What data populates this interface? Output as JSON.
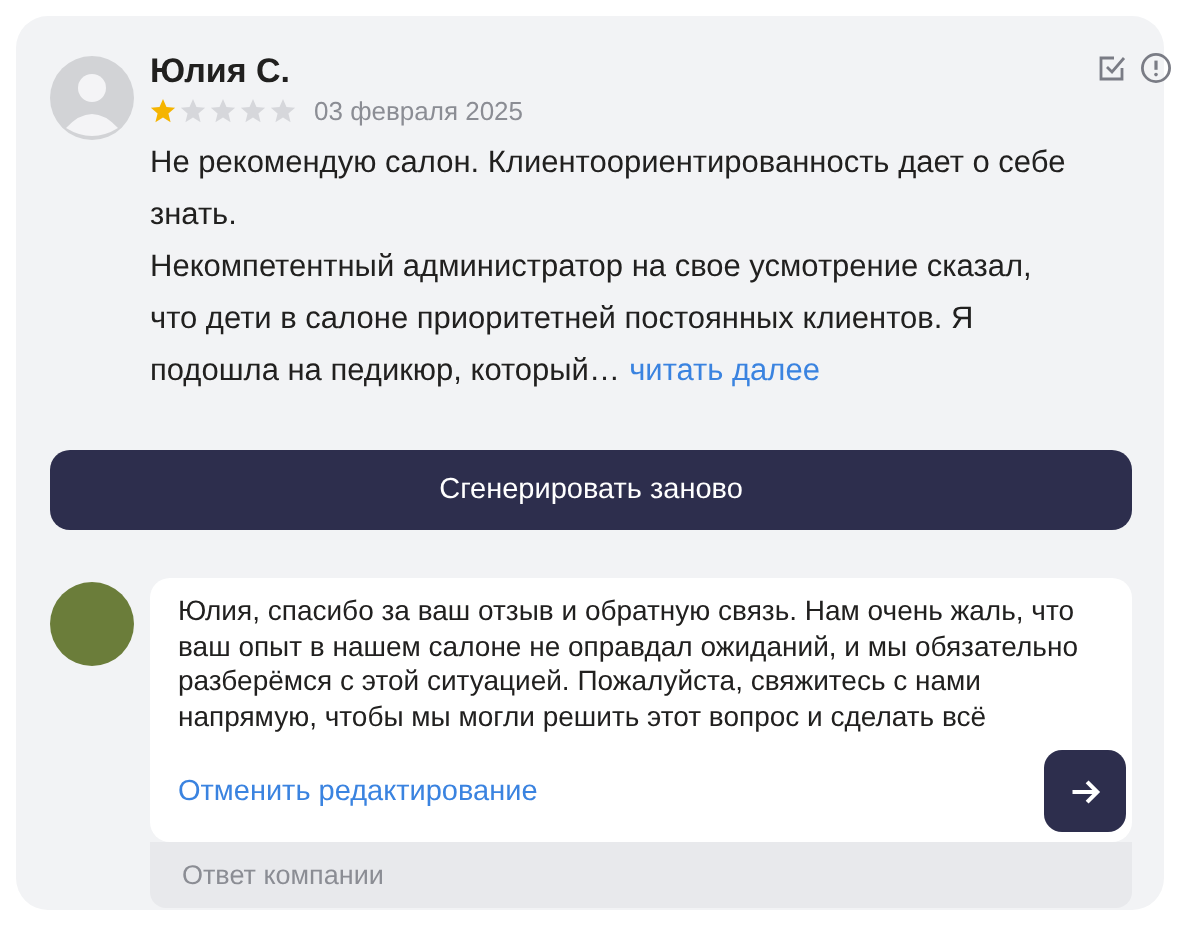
{
  "review": {
    "author": "Юлия С.",
    "stars": 1,
    "date": "03 февраля 2025",
    "paragraphs": [
      "Не рекомендую салон. Клиентоориентированность дает о себе знать.",
      "Некомпетентный администратор на свое усмотрение сказал, что дети в салоне приоритетней постоянных клиентов. Я подошла на педикюр, который…"
    ],
    "read_more": "читать далее"
  },
  "regenerate_button": "Сгенерировать заново",
  "reply": {
    "value": "Юлия, спасибо за ваш отзыв и обратную связь. Нам очень жаль, что ваш опыт в нашем салоне не оправдал ожиданий, и мы обязательно разберёмся с этой ситуацией. Пожалуйста, свяжитесь с нами напрямую, чтобы мы могли решить этот вопрос и сделать всё",
    "cancel_link": "Отменить редактирование",
    "caption": "Ответ компании"
  }
}
